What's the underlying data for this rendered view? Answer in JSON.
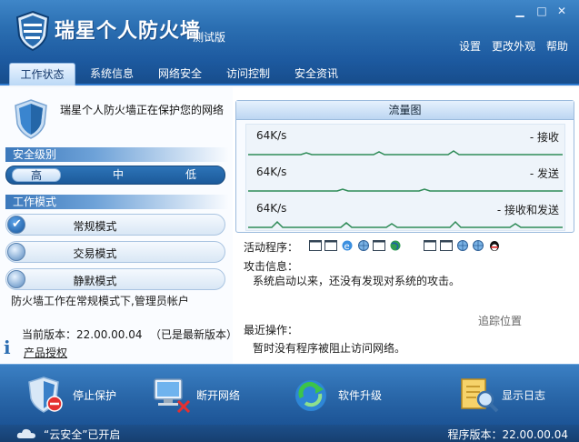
{
  "window": {
    "title": "瑞星个人防火墙",
    "subtitle": "测试版",
    "controls": [
      "minimize",
      "maximize",
      "close"
    ]
  },
  "top_links": {
    "settings": "设置",
    "change_skin": "更改外观",
    "help": "帮助"
  },
  "tabs": [
    {
      "label": "工作状态",
      "active": true
    },
    {
      "label": "系统信息",
      "active": false
    },
    {
      "label": "网络安全",
      "active": false
    },
    {
      "label": "访问控制",
      "active": false
    },
    {
      "label": "安全资讯",
      "active": false
    }
  ],
  "left": {
    "protect_message": "瑞星个人防火墙正在保护您的网络",
    "security_level": {
      "header": "安全级别",
      "levels": [
        "高",
        "中",
        "低"
      ],
      "selected": "高"
    },
    "work_mode": {
      "header": "工作模式",
      "modes": [
        {
          "label": "常规模式",
          "checked": true
        },
        {
          "label": "交易模式",
          "checked": false
        },
        {
          "label": "静默模式",
          "checked": false
        }
      ]
    },
    "status_text": "防火墙工作在常规模式下,管理员帐户",
    "current_version": "当前版本：22.00.00.04",
    "latest_note": "（已是最新版本）",
    "license_link": "产品授权"
  },
  "traffic": {
    "title": "流量图",
    "rows": [
      {
        "speed": "64K/s",
        "label": "- 接收"
      },
      {
        "speed": "64K/s",
        "label": "- 发送"
      },
      {
        "speed": "64K/s",
        "label": "- 接收和发送"
      }
    ]
  },
  "activity": {
    "programs_label": "活动程序：",
    "attack_label": "攻击信息：",
    "attack_text": "系统启动以来，还没有发现对系统的攻击。",
    "trace_link": "追踪位置",
    "recent_label": "最近操作：",
    "recent_text": "暂时没有程序被阻止访问网络。"
  },
  "toolbar": {
    "stop": "停止保护",
    "disconnect": "断开网络",
    "upgrade": "软件升级",
    "log": "显示日志"
  },
  "statusbar": {
    "cloud": "“云安全”已开启",
    "version": "程序版本：22.00.00.04"
  },
  "colors": {
    "header_blue": "#2b6fb2",
    "toolbar_blue": "#2a68aa",
    "graph_line": "#2e8b57",
    "accent_light": "#bcd9f6"
  }
}
